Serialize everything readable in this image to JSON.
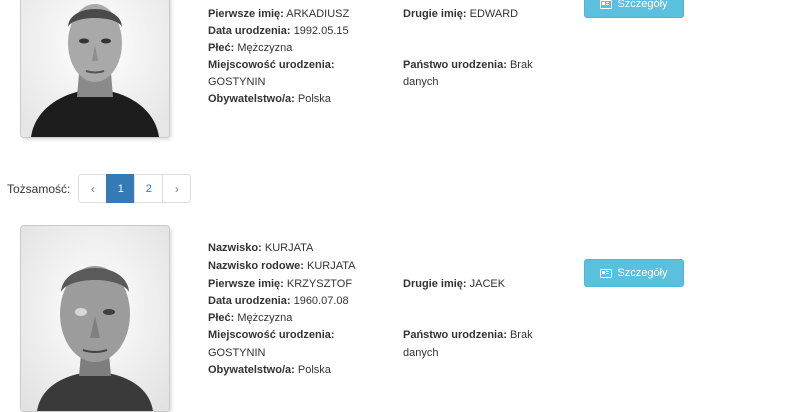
{
  "records": [
    {
      "first_name_label": "Pierwsze imię:",
      "first_name": "ARKADIUSZ",
      "second_name_label": "Drugie imię:",
      "second_name": "EDWARD",
      "birth_date_label": "Data urodzenia:",
      "birth_date": "1992.05.15",
      "sex_label": "Płeć:",
      "sex": "Mężczyzna",
      "birthplace_label": "Miejscowość urodzenia:",
      "birthplace": "GOSTYNIN",
      "birth_country_label": "Państwo urodzenia:",
      "birth_country_line1": "Brak",
      "birth_country_line2": "danych",
      "citizenship_label": "Obywatelstwo/a:",
      "citizenship": "Polska",
      "details_button": "Szczegóły"
    },
    {
      "surname_label": "Nazwisko:",
      "surname": "KURJATA",
      "family_name_label": "Nazwisko rodowe:",
      "family_name": "KURJATA",
      "first_name_label": "Pierwsze imię:",
      "first_name": "KRZYSZTOF",
      "second_name_label": "Drugie imię:",
      "second_name": "JACEK",
      "birth_date_label": "Data urodzenia:",
      "birth_date": "1960.07.08",
      "sex_label": "Płeć:",
      "sex": "Mężczyzna",
      "birthplace_label": "Miejscowość urodzenia:",
      "birthplace": "GOSTYNIN",
      "birth_country_label": "Państwo urodzenia:",
      "birth_country_line1": "Brak",
      "birth_country_line2": "danych",
      "citizenship_label": "Obywatelstwo/a:",
      "citizenship": "Polska",
      "details_button": "Szczegóły"
    }
  ],
  "pagination": {
    "label": "Tożsamość:",
    "prev": "‹",
    "pages": [
      "1",
      "2"
    ],
    "active_page": "1",
    "next": "›"
  },
  "icons": {
    "details_button_icon": "id-card-icon"
  },
  "colors": {
    "info_button": "#5bc0de",
    "active_page": "#337ab7"
  }
}
